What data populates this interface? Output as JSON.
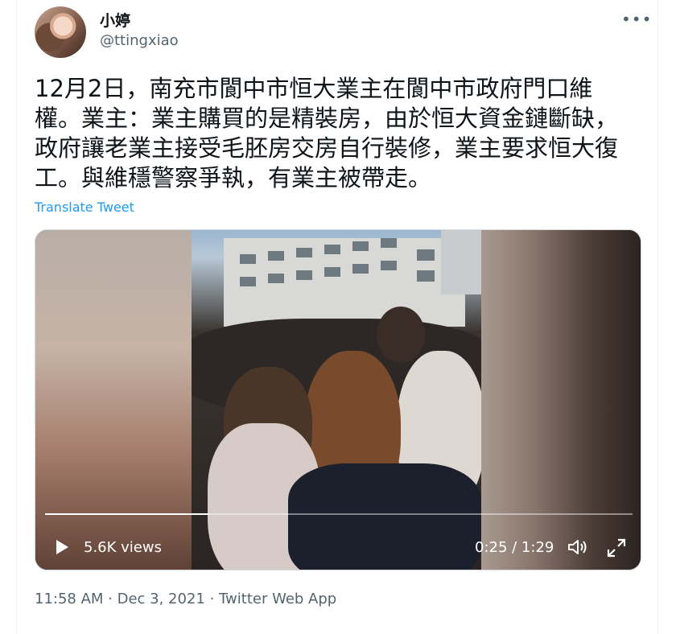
{
  "user": {
    "display_name": "小婷",
    "handle": "@ttingxiao"
  },
  "more_icon": "more-horizontal-icon",
  "tweet": {
    "text": "12月2日，南充市閬中市恒大業主在閬中市政府門口維權。業主：業主購買的是精裝房，由於恒大資金鏈斷缺，政府讓老業主接受毛胚房交房自行裝修，業主要求恒大復工。與維穩警察爭執，有業主被帶走。",
    "translate_label": "Translate Tweet"
  },
  "video": {
    "views": "5.6K views",
    "time": "0:25 / 1:29",
    "progress": 0.28,
    "play_icon": "play-icon",
    "volume_icon": "volume-icon",
    "fullscreen_icon": "fullscreen-icon"
  },
  "meta": {
    "timestamp": "11:58 AM · Dec 3, 2021 · Twitter Web App"
  },
  "colors": {
    "link": "#1d9bf0",
    "secondary_text": "#536471",
    "primary_text": "#0f1419"
  }
}
